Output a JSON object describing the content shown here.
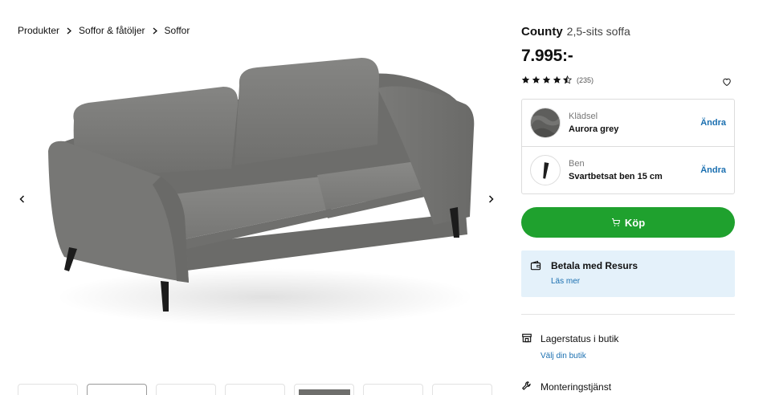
{
  "breadcrumb": [
    "Produkter",
    "Soffor & fåtöljer",
    "Soffor"
  ],
  "product": {
    "name": "County",
    "subtitle": "2,5-sits soffa",
    "price": "7.995:-",
    "rating": 4.5,
    "rating_count": "(235)"
  },
  "options": [
    {
      "label": "Klädsel",
      "value": "Aurora grey",
      "action": "Ändra",
      "icon": "fabric-swatch"
    },
    {
      "label": "Ben",
      "value": "Svartbetsat ben 15 cm",
      "action": "Ändra",
      "icon": "sofa-leg"
    }
  ],
  "buy_button": {
    "label": "Köp",
    "color": "#1fa12e"
  },
  "payment": {
    "title": "Betala med Resurs",
    "link": "Läs mer",
    "background": "#e4f1fa"
  },
  "stock": {
    "title": "Lagerstatus i butik",
    "link": "Välj din butik",
    "icon": "store-icon"
  },
  "assembly": {
    "title": "Monteringstjänst",
    "icon": "wrench-icon"
  },
  "thumbnails_count": 7,
  "active_thumbnail": 1,
  "colors": {
    "accent": "#1a6fb0",
    "buy": "#1fa12e",
    "sofa": "#7b7b79"
  }
}
